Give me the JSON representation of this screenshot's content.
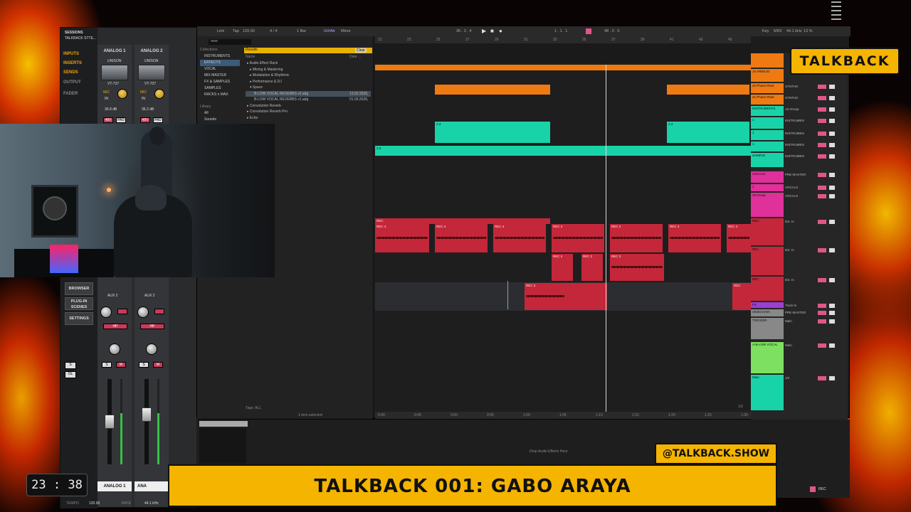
{
  "uad": {
    "header": "SESSIONS",
    "session_name": "TALKBACK STTE...",
    "nav": [
      {
        "label": "INPUTS",
        "active": true
      },
      {
        "label": "INSERTS",
        "active": true
      },
      {
        "label": "SENDS",
        "active": true
      },
      {
        "label": "OUTPUT",
        "active": false
      },
      {
        "label": "FADER",
        "active": false
      }
    ],
    "side_buttons": [
      "BROWSER",
      "PLUG-IN SCENES",
      "SETTINGS"
    ],
    "channels": [
      {
        "name": "ANALOG 1",
        "preamp": "UNISON",
        "plugin": "VT-737",
        "mic": "MIC",
        "in": "IN",
        "gain": "36.8 dB",
        "v48": "48V",
        "pad": "PAD",
        "aux": "AUX 2",
        "hp": "HP",
        "name_footer": "ANALOG 1"
      },
      {
        "name": "ANALOG 2",
        "preamp": "UNISON",
        "plugin": "VT-737",
        "mic": "MIC",
        "in": "IN",
        "gain": "36.2 dB",
        "v48": "48V",
        "pad": "PAD",
        "aux": "AUX 2",
        "hp": "HP",
        "name_footer": "ANA"
      }
    ],
    "solo": "S",
    "mute": "M",
    "ol": "OL",
    "footer": {
      "tempo_label": "TEMPO",
      "tempo": "120.00",
      "rate_label": "RATE",
      "rate": "44.1 kHz"
    }
  },
  "ableton": {
    "control_bar": {
      "link": "Link",
      "tap": "Tap",
      "bpm": "120.00",
      "sig": "4 / 4",
      "quant": "1 Bar",
      "key": "G#/Ab",
      "scale": "Minor",
      "position": "36 . 3 . 4",
      "loop_start": "1 . 1 . 1",
      "loop_len": "48 . 0 . 0",
      "midi": "MIDI",
      "rate": "44.1 kHz",
      "cpu": "13 %",
      "key_label": "Key"
    },
    "browser": {
      "search_placeholder": "rave",
      "collections_label": "Collections",
      "results_label": "Results",
      "clear_label": "Clear",
      "name_col": "Name",
      "date_col": "Date ...",
      "categories": [
        "INSTRUMENTS",
        "EFFECTS",
        "VOCAL",
        "MIX MASTER",
        "FX & SAMPLES",
        "SAMPLES",
        "RACKS n MAX"
      ],
      "library_label": "Library",
      "library_items": [
        "All",
        "Sounds"
      ],
      "rows": [
        {
          "name": "Audio Effect Rack",
          "date": ""
        },
        {
          "name": "Mixing & Mastering",
          "date": ""
        },
        {
          "name": "Modulation & Rhythmic",
          "date": ""
        },
        {
          "name": "Performance & DJ",
          "date": ""
        },
        {
          "name": "Space",
          "date": ""
        },
        {
          "name": "B-LOW VOCAL REVERBS v2.adg",
          "date": "13.02.2026,"
        },
        {
          "name": "B-LOW VOCAL REVERBS v1.adg",
          "date": "01.03.2026,"
        },
        {
          "name": "Convolution Reverb",
          "date": ""
        },
        {
          "name": "Convolution Reverb Pro",
          "date": ""
        },
        {
          "name": "Echo",
          "date": ""
        }
      ],
      "tags_label": "Tags",
      "tags_value": "ALL",
      "status": "1 item selected"
    },
    "ruler": [
      "21",
      "23",
      "25",
      "27",
      "29",
      "31",
      "33",
      "35",
      "37",
      "39",
      "41",
      "43",
      "45"
    ],
    "time_ruler": [
      "0:40",
      "0:45",
      "0:50",
      "0:55",
      "1:00",
      "1:05",
      "1:10",
      "1:15",
      "1:20",
      "1:25",
      "1:30"
    ],
    "clip_labels": {
      "rec": "REC",
      "rec4": "REC 4",
      "rec2": "REC 2",
      "rec3": "REC 3",
      "v": "2.3"
    },
    "page_indicator": "1/2",
    "drop_text": "Drop Audio Effects Here",
    "tracks": [
      {
        "name": "",
        "color": "#ef7a12"
      },
      {
        "name": "19 ARREJO",
        "color": "#ef7a12",
        "route": ""
      },
      {
        "name": "20 Phase Plant",
        "color": "#ef7a12",
        "route": "SYNTHS"
      },
      {
        "name": "21 Phase Plant",
        "color": "#ef7a12",
        "route": "SYNTHS"
      },
      {
        "name": "INSTRUMENTS",
        "color": "#19d3a8",
        "route": "1S-Group"
      },
      {
        "name": "1",
        "color": "#19d3a8",
        "route": "INSTRUMEN"
      },
      {
        "name": "1",
        "color": "#19d3a8",
        "route": "INSTRUMEN"
      },
      {
        "name": "1",
        "color": "#19d3a8",
        "route": "INSTRUMEN"
      },
      {
        "name": "SAMPLE",
        "color": "#19d3a8",
        "route": "INSTRUMEN"
      },
      {
        "name": "VOCALS",
        "color": "#e0309a",
        "route": "PRE MASTER"
      },
      {
        "name": "1",
        "color": "#e0309a",
        "route": "VOCALS"
      },
      {
        "name": "29 Group",
        "color": "#e0309a",
        "route": "VOCALS"
      },
      {
        "name": "REC",
        "color": "#c4273a",
        "route": "Ext. In"
      },
      {
        "name": "REC",
        "color": "#c4273a",
        "route": "Ext. In"
      },
      {
        "name": "REC",
        "color": "#c4273a",
        "route": "Ext. In"
      },
      {
        "name": "FX",
        "color": "#9a40d0",
        "route": "Track In"
      },
      {
        "name": "SIDECHAIN",
        "color": "#888888",
        "route": "PRE MASTER"
      },
      {
        "name": "TRIGGER",
        "color": "#888888",
        "route": "Main"
      },
      {
        "name": "A-B-LOW VOCAL",
        "color": "#7ee060",
        "route": "Main"
      },
      {
        "name": "Main",
        "color": "#19d3a8",
        "route": "1/2"
      }
    ]
  },
  "overlay": {
    "badge": "TALKBACK",
    "handle": "@TALKBACK.SHOW",
    "title": "TALKBACK 001: GABO ARAYA",
    "clock": "23 : 38"
  },
  "colors": {
    "accent": "#f4b400",
    "clip_orange": "#ef7a12",
    "clip_cyan": "#19d3a8",
    "clip_red": "#c4273a"
  }
}
